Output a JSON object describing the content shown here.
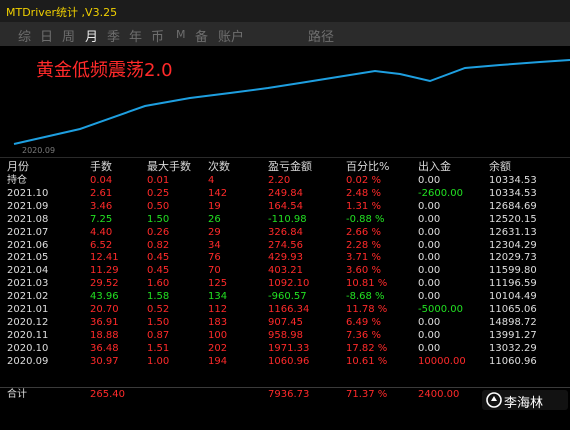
{
  "window": {
    "title": "MTDriver统计 ,V3.25"
  },
  "tabs": [
    {
      "label": "综"
    },
    {
      "label": "日"
    },
    {
      "label": "周"
    },
    {
      "label": "月"
    },
    {
      "label": "季"
    },
    {
      "label": "年"
    },
    {
      "label": "币"
    },
    {
      "label": "M"
    },
    {
      "label": "备"
    },
    {
      "label": "账户"
    },
    {
      "label": "路径"
    }
  ],
  "active_tab": "月",
  "chart": {
    "title": "黄金低频震荡2.0",
    "x_start_label": "2020.09",
    "line_color": "#1e9fe0",
    "title_color": "#ff2a2a"
  },
  "chart_data": {
    "type": "line",
    "title": "黄金低频震荡2.0",
    "categories": [
      "2020.09",
      "2020.10",
      "2020.11",
      "2020.12",
      "2021.01",
      "2021.02",
      "2021.03",
      "2021.04",
      "2021.05",
      "2021.06",
      "2021.07",
      "2021.08",
      "2021.09",
      "2021.10"
    ],
    "series": [
      {
        "values": [
          11060.96,
          13032.29,
          13991.27,
          14898.72,
          11065.06,
          10104.49,
          11196.59,
          11599.8,
          12029.73,
          12304.29,
          12631.13,
          12520.15,
          12684.69,
          10334.53
        ]
      }
    ]
  },
  "table": {
    "headers": [
      "月份",
      "手数",
      "最大手数",
      "次数",
      "盈亏金额",
      "百分比%",
      "出入金",
      "余额"
    ],
    "rows": [
      {
        "cells": [
          "持仓",
          "0.04",
          "0.01",
          "4",
          "2.20",
          "0.02 %",
          "0.00",
          "10334.53"
        ],
        "color": "red"
      },
      {
        "cells": [
          "2021.10",
          "2.61",
          "0.25",
          "142",
          "249.84",
          "2.48 %",
          "-2600.00",
          "10334.53"
        ],
        "color": "red"
      },
      {
        "cells": [
          "2021.09",
          "3.46",
          "0.50",
          "19",
          "164.54",
          "1.31 %",
          "0.00",
          "12684.69"
        ],
        "color": "red"
      },
      {
        "cells": [
          "2021.08",
          "7.25",
          "1.50",
          "26",
          "-110.98",
          "-0.88 %",
          "0.00",
          "12520.15"
        ],
        "color": "green"
      },
      {
        "cells": [
          "2021.07",
          "4.40",
          "0.26",
          "29",
          "326.84",
          "2.66 %",
          "0.00",
          "12631.13"
        ],
        "color": "red"
      },
      {
        "cells": [
          "2021.06",
          "6.52",
          "0.82",
          "34",
          "274.56",
          "2.28 %",
          "0.00",
          "12304.29"
        ],
        "color": "red"
      },
      {
        "cells": [
          "2021.05",
          "12.41",
          "0.45",
          "76",
          "429.93",
          "3.71 %",
          "0.00",
          "12029.73"
        ],
        "color": "red"
      },
      {
        "cells": [
          "2021.04",
          "11.29",
          "0.45",
          "70",
          "403.21",
          "3.60 %",
          "0.00",
          "11599.80"
        ],
        "color": "red"
      },
      {
        "cells": [
          "2021.03",
          "29.52",
          "1.60",
          "125",
          "1092.10",
          "10.81 %",
          "0.00",
          "11196.59"
        ],
        "color": "red"
      },
      {
        "cells": [
          "2021.02",
          "43.96",
          "1.58",
          "134",
          "-960.57",
          "-8.68 %",
          "0.00",
          "10104.49"
        ],
        "color": "green"
      },
      {
        "cells": [
          "2021.01",
          "20.70",
          "0.52",
          "112",
          "1166.34",
          "11.78 %",
          "-5000.00",
          "11065.06"
        ],
        "color": "red"
      },
      {
        "cells": [
          "2020.12",
          "36.91",
          "1.50",
          "183",
          "907.45",
          "6.49 %",
          "0.00",
          "14898.72"
        ],
        "color": "red"
      },
      {
        "cells": [
          "2020.11",
          "18.88",
          "0.87",
          "100",
          "958.98",
          "7.36 %",
          "0.00",
          "13991.27"
        ],
        "color": "red"
      },
      {
        "cells": [
          "2020.10",
          "36.48",
          "1.51",
          "202",
          "1971.33",
          "17.82 %",
          "0.00",
          "13032.29"
        ],
        "color": "red"
      },
      {
        "cells": [
          "2020.09",
          "30.97",
          "1.00",
          "194",
          "1060.96",
          "10.61 %",
          "10000.00",
          "11060.96"
        ],
        "color": "red"
      }
    ],
    "total": [
      "合计",
      "265.40",
      "",
      "",
      "7936.73",
      "71.37 %",
      "2400.00",
      ""
    ]
  },
  "watermark": {
    "text": "李海林"
  }
}
